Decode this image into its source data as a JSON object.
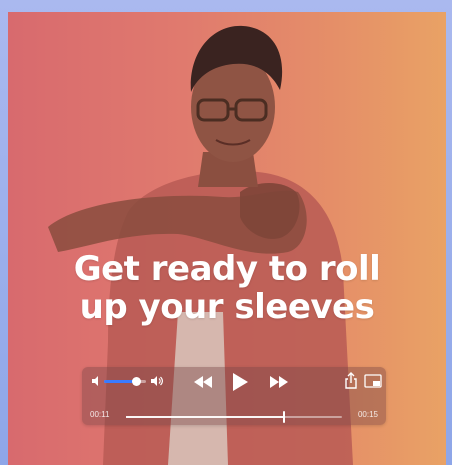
{
  "video": {
    "headline_line1": "Get ready to roll",
    "headline_line2": "up your sleeves",
    "background_colors": [
      "#d86a6e",
      "#e07a6e",
      "#e58f68",
      "#e9a265"
    ]
  },
  "player": {
    "time_elapsed": "00:11",
    "time_remaining": "00:15",
    "progress_fraction": 0.73,
    "volume_fraction": 0.78,
    "accent_color": "#3a7bff",
    "icons": {
      "volume_low": "speaker-low-icon",
      "volume_high": "speaker-high-icon",
      "rewind": "rewind-icon",
      "play": "play-icon",
      "forward": "fast-forward-icon",
      "share": "share-icon",
      "pip": "picture-in-picture-icon"
    }
  }
}
